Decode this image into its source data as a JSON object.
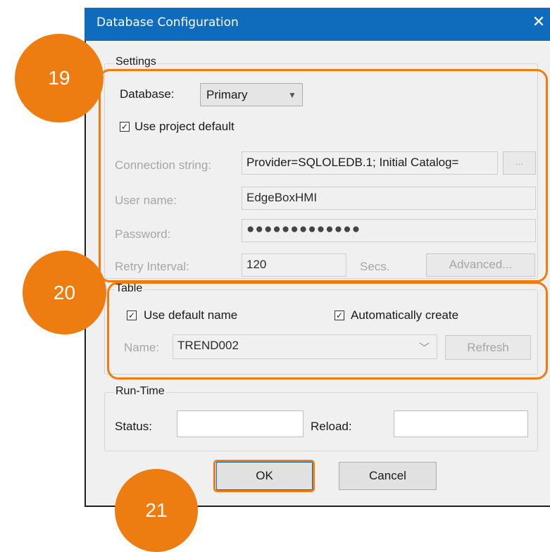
{
  "dialog": {
    "title": "Database Configuration",
    "close_label": "✕"
  },
  "settings": {
    "legend": "Settings",
    "database_label": "Database:",
    "database_value": "Primary",
    "use_project_default_label": "Use project default",
    "use_project_default_checked": true,
    "connection_string_label": "Connection string:",
    "connection_string_value": "Provider=SQLOLEDB.1; Initial Catalog=",
    "browse_label": "...",
    "user_name_label": "User name:",
    "user_name_value": "EdgeBoxHMI",
    "password_label": "Password:",
    "password_value": "●●●●●●●●●●●●●",
    "retry_interval_label": "Retry Interval:",
    "retry_interval_value": "120",
    "secs_label": "Secs.",
    "advanced_label": "Advanced..."
  },
  "table": {
    "legend": "Table",
    "use_default_name_label": "Use default name",
    "use_default_name_checked": true,
    "auto_create_label": "Automatically create",
    "auto_create_checked": true,
    "name_label": "Name:",
    "name_value": "TREND002",
    "refresh_label": "Refresh"
  },
  "runtime": {
    "legend": "Run-Time",
    "status_label": "Status:",
    "status_value": "",
    "reload_label": "Reload:",
    "reload_value": ""
  },
  "buttons": {
    "ok_label": "OK",
    "cancel_label": "Cancel"
  },
  "callouts": {
    "c19": "19",
    "c20": "20",
    "c21": "21"
  },
  "colors": {
    "titlebar": "#0f6cbd",
    "callout": "#ed7d10"
  }
}
